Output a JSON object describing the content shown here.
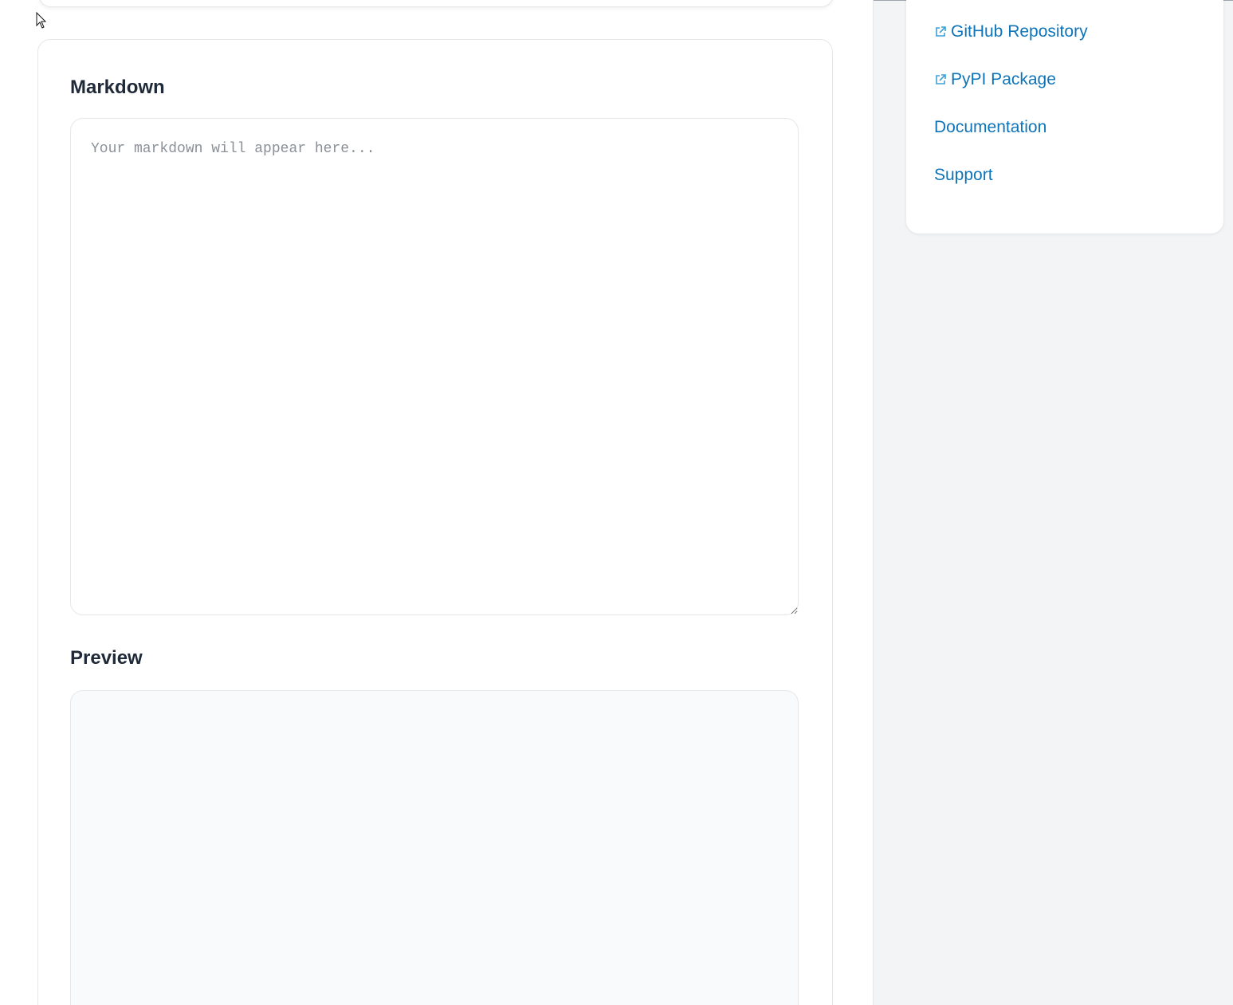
{
  "editor": {
    "markdown_title": "Markdown",
    "markdown_placeholder": "Your markdown will appear here...",
    "markdown_value": "",
    "preview_title": "Preview"
  },
  "sidebar": {
    "links": [
      {
        "label": "GitHub Repository",
        "icon": "external-link-icon"
      },
      {
        "label": "PyPI Package",
        "icon": "external-link-icon"
      },
      {
        "label": "Documentation",
        "icon": ""
      },
      {
        "label": "Support",
        "icon": ""
      }
    ]
  },
  "colors": {
    "link": "#0e74b8",
    "heading": "#1f2937",
    "border": "#e5e7eb",
    "sidebar_bg": "#f3f4f6",
    "preview_bg": "#f9fafb"
  }
}
